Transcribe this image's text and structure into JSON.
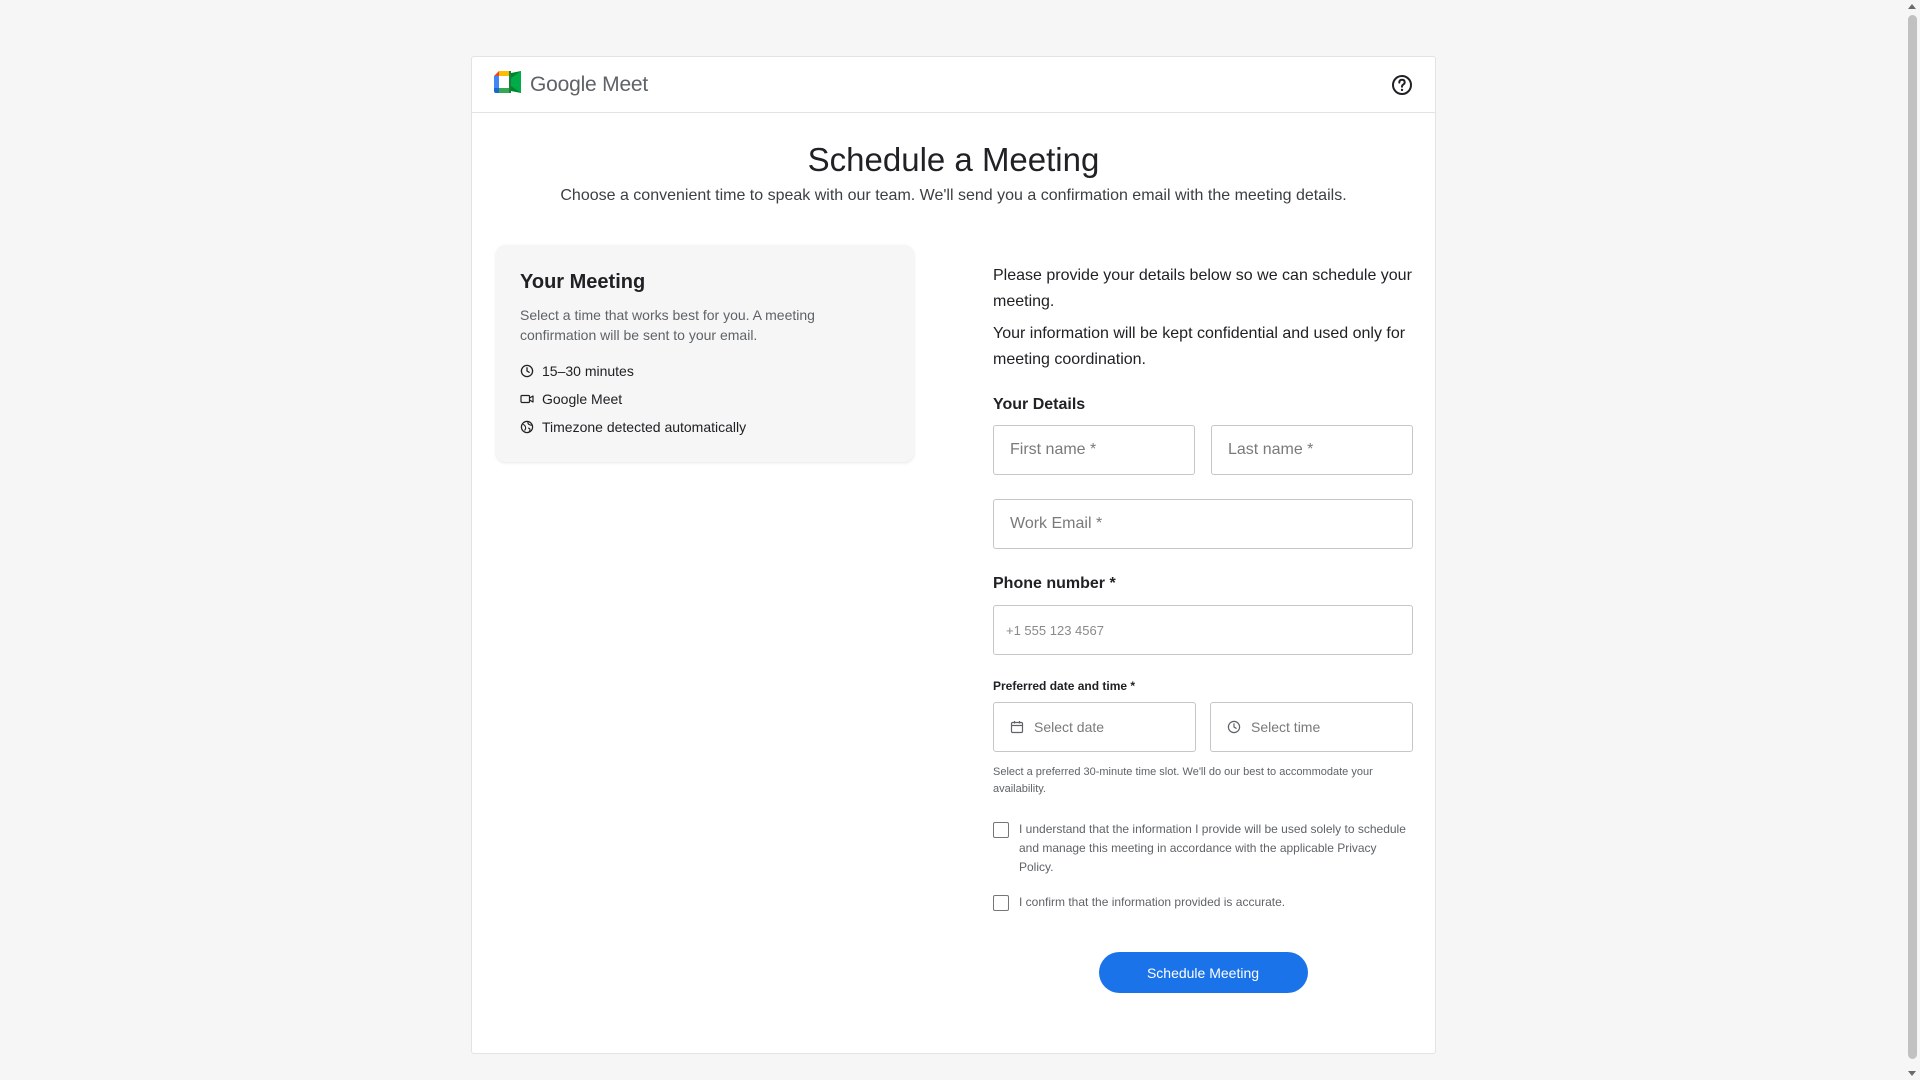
{
  "colors": {
    "accent": "#1a73e8",
    "page_background": "#f6f6f6",
    "card_background": "#ffffff"
  },
  "header": {
    "brand_name": "Google Meet",
    "logo_icon": "google-meet-logo",
    "help_icon": "help-circle-icon"
  },
  "hero": {
    "title": "Schedule a Meeting",
    "subtitle": "Choose a convenient time to speak with our team. We'll send you a confirmation email with the meeting details."
  },
  "meeting": {
    "title": "Your Meeting",
    "description": "Select a time that works best for you. A meeting confirmation will be sent to your email.",
    "items": [
      {
        "icon": "clock-icon",
        "label": "15–30 minutes"
      },
      {
        "icon": "video-camera-icon",
        "label": "Google Meet"
      },
      {
        "icon": "globe-icon",
        "label": "Timezone detected automatically"
      }
    ]
  },
  "form": {
    "intro_1": "Please provide your details below so we can schedule your meeting.",
    "intro_2": "Your information will be kept confidential and used only for meeting coordination.",
    "details_title": "Your Details",
    "first_name": {
      "value": "",
      "placeholder": "First name *"
    },
    "last_name": {
      "value": "",
      "placeholder": "Last name *"
    },
    "email": {
      "value": "",
      "placeholder": "Work Email *"
    },
    "phone_label": "Phone number *",
    "phone": {
      "value": "",
      "placeholder": "+1 555 123 4567"
    },
    "datetime_label": "Preferred date and time *",
    "date_placeholder": "Select date",
    "time_placeholder": "Select time",
    "hint": "Select a preferred 30-minute time slot. We'll do our best to accommodate your availability.",
    "consent_privacy": {
      "checked": false,
      "label": "I understand that the information I provide will be used solely to schedule and manage this meeting in accordance with the applicable Privacy Policy."
    },
    "consent_accuracy": {
      "checked": false,
      "label": "I confirm that the information provided is accurate."
    },
    "submit_label": "Schedule Meeting"
  }
}
